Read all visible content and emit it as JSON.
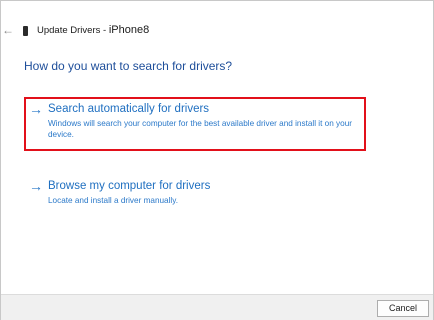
{
  "window": {
    "title": "Update Drivers - ",
    "device_name": "iPhone8"
  },
  "main": {
    "question": "How do you want to search for drivers?",
    "options": [
      {
        "title": "Search automatically for drivers",
        "description": "Windows will search your computer for the best available driver and install it on your device.",
        "icon": "arrow-right-icon"
      },
      {
        "title": "Browse my computer for drivers",
        "description": "Locate and install a driver manually.",
        "icon": "arrow-right-icon"
      }
    ]
  },
  "footer": {
    "cancel_label": "Cancel"
  },
  "colors": {
    "link_blue": "#1f6fc0",
    "heading_blue": "#1e4e9a",
    "highlight_red": "#e2101a"
  }
}
